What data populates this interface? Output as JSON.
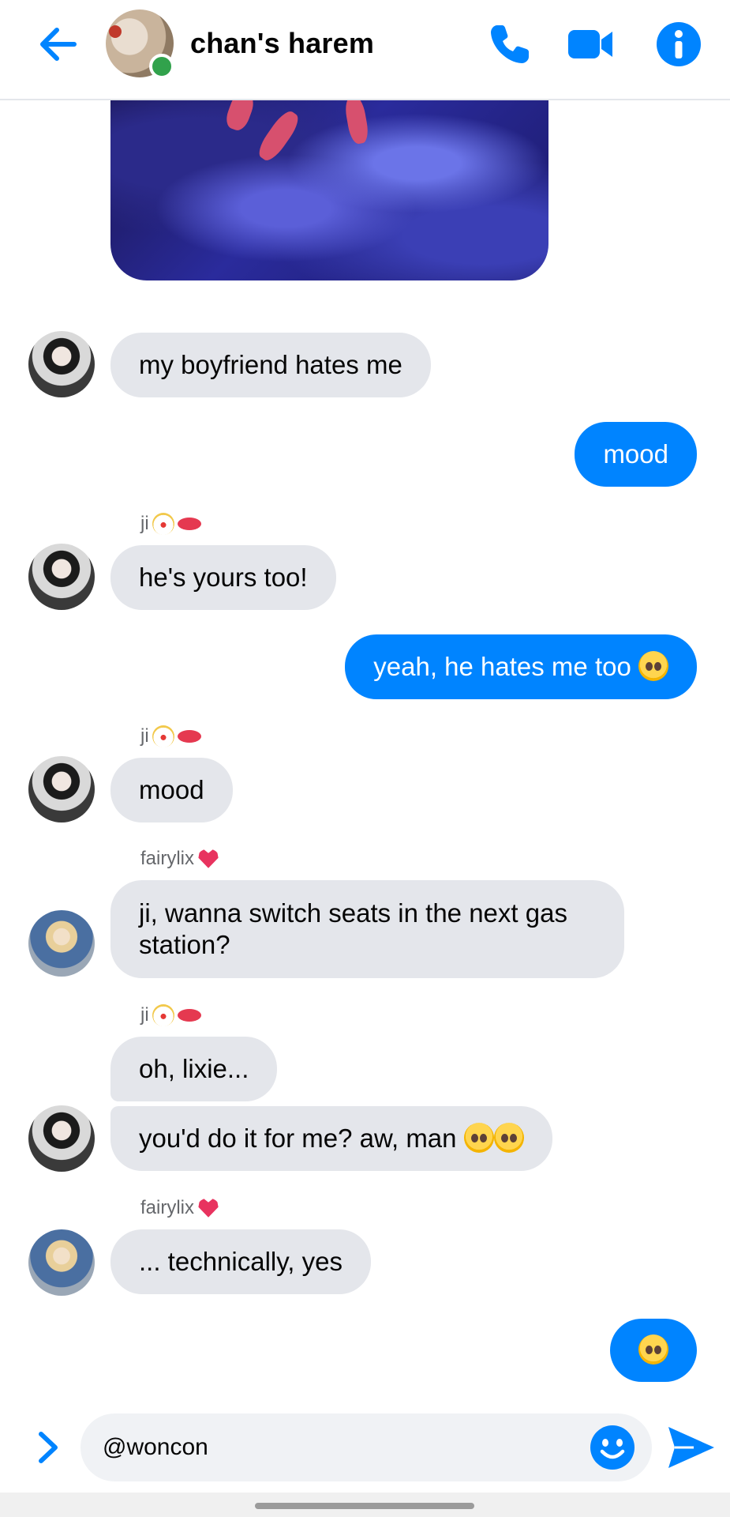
{
  "header": {
    "title": "chan's harem",
    "back_icon": "arrow-left-icon",
    "call_icon": "phone-icon",
    "video_icon": "video-camera-icon",
    "info_icon": "info-icon",
    "accent_color": "#0084ff",
    "online_color": "#31a24c"
  },
  "messages": [
    {
      "type": "image",
      "from": "other"
    },
    {
      "type": "text",
      "from": "ji",
      "text": "my boyfriend hates me"
    },
    {
      "type": "text",
      "from": "me",
      "text": "mood"
    },
    {
      "type": "text",
      "from": "ji",
      "sender_label": "ji",
      "text": "he's yours too!"
    },
    {
      "type": "text",
      "from": "me",
      "text": "yeah, he hates me too",
      "emoji": "saluting-face"
    },
    {
      "type": "text",
      "from": "ji",
      "sender_label": "ji",
      "text": "mood"
    },
    {
      "type": "text",
      "from": "fairylix",
      "sender_label": "fairylix",
      "text": "ji, wanna switch seats in the next gas station?"
    },
    {
      "type": "text",
      "from": "ji",
      "sender_label": "ji",
      "text": "oh, lixie..."
    },
    {
      "type": "text",
      "from": "ji",
      "text": "you'd do it for me? aw, man",
      "emoji": "pleading-face x2"
    },
    {
      "type": "text",
      "from": "fairylix",
      "sender_label": "fairylix",
      "text": "... technically, yes"
    },
    {
      "type": "emoji",
      "from": "me",
      "emoji": "face-with-raised-eyebrow"
    }
  ],
  "composer": {
    "input_value": "@woncon",
    "expand_icon": "chevron-right-icon",
    "emoji_icon": "smiley-icon",
    "send_icon": "send-icon"
  },
  "colors": {
    "incoming_bubble": "#e4e6eb",
    "outgoing_bubble": "#0084ff",
    "sender_label": "#65676b"
  }
}
